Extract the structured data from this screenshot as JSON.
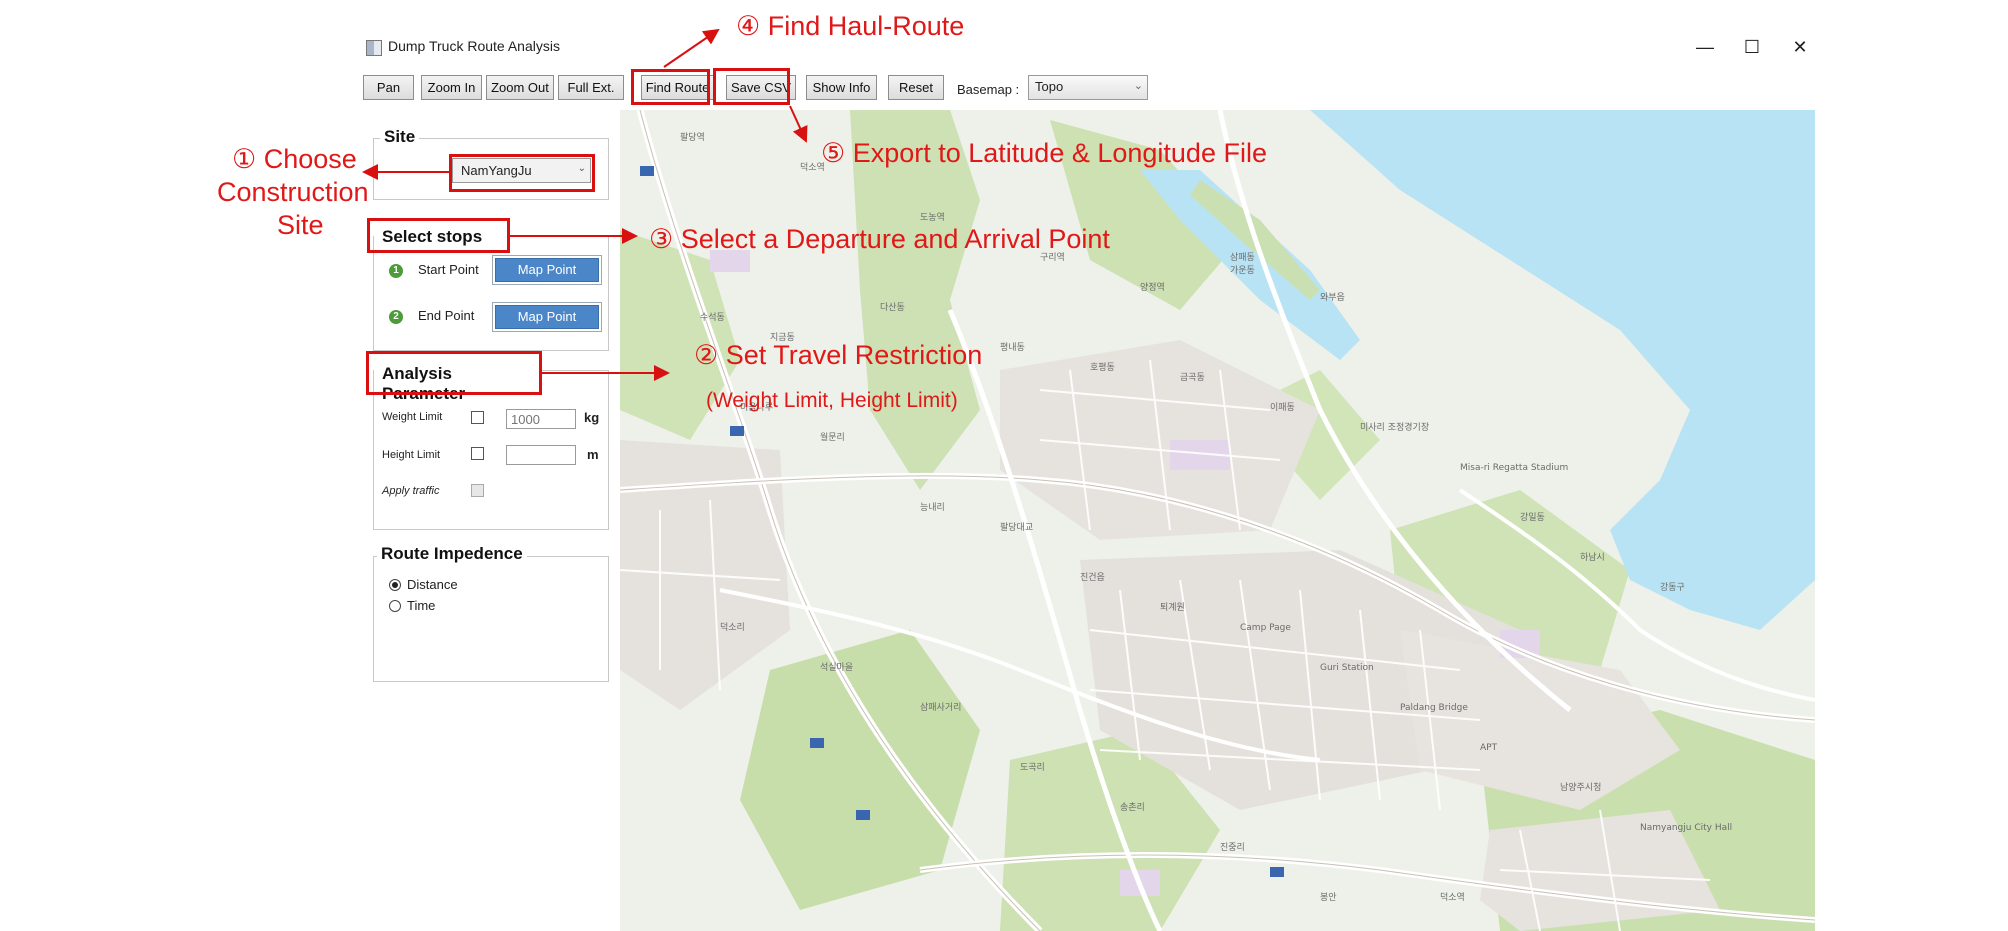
{
  "window": {
    "title": "Dump Truck Route Analysis",
    "controls": {
      "minimize": "—",
      "maximize": "☐",
      "close": "✕"
    }
  },
  "toolbar": {
    "pan": "Pan",
    "zoom_in": "Zoom In",
    "zoom_out": "Zoom Out",
    "full_extent": "Full Ext.",
    "find_route": "Find Route",
    "save_csv": "Save CSV",
    "show_info": "Show Info",
    "reset": "Reset",
    "basemap_label": "Basemap :",
    "basemap_value": "Topo"
  },
  "site": {
    "title": "Site",
    "selected": "NamYangJu"
  },
  "stops": {
    "title": "Select stops",
    "start_number": "1",
    "start_label": "Start Point",
    "end_number": "2",
    "end_label": "End Point",
    "map_point": "Map Point"
  },
  "params": {
    "title": "Analysis Parameter",
    "weight_label": "Weight Limit",
    "weight_placeholder": "1000",
    "weight_unit": "kg",
    "height_label": "Height Limit",
    "height_unit": "m",
    "traffic_label": "Apply traffic"
  },
  "impedance": {
    "title": "Route Impedence",
    "distance": "Distance",
    "time": "Time",
    "selected": "Distance"
  },
  "annotations": {
    "choose_site_1": "① Choose",
    "choose_site_2": "Construction",
    "choose_site_3": "Site",
    "set_restriction": "② Set Travel Restriction",
    "restriction_detail": "(Weight Limit, Height Limit)",
    "select_points": "③ Select a Departure and Arrival Point",
    "find_route": "④ Find Haul-Route",
    "export": "⑤ Export to Latitude & Longitude File"
  },
  "map": {
    "labels": [
      "팔당역",
      "덕소역",
      "도농역",
      "구리역",
      "양정역",
      "와부읍",
      "삼패동",
      "가운동",
      "수석동",
      "지금동",
      "다산동",
      "평내동",
      "호평동",
      "금곡동",
      "이패동",
      "미사리 조정경기장",
      "Misa-ri Regatta Stadium",
      "강일동",
      "하남시",
      "강동구",
      "미음나루",
      "월문리",
      "능내리",
      "팔당대교",
      "진건읍",
      "퇴계원",
      "Camp Page",
      "Guri Station",
      "Paldang Bridge",
      "APT",
      "남양주시청",
      "Namyangju City Hall",
      "덕소리",
      "석실마을",
      "삼패사거리",
      "도곡리",
      "송촌리",
      "진중리",
      "봉안",
      "덕소역"
    ]
  },
  "colors": {
    "annotation": "#e01818",
    "map_point_button": "#4a86c8",
    "water": "#b8e3f5",
    "park": "#c6dfa8",
    "road": "#ffffff"
  }
}
